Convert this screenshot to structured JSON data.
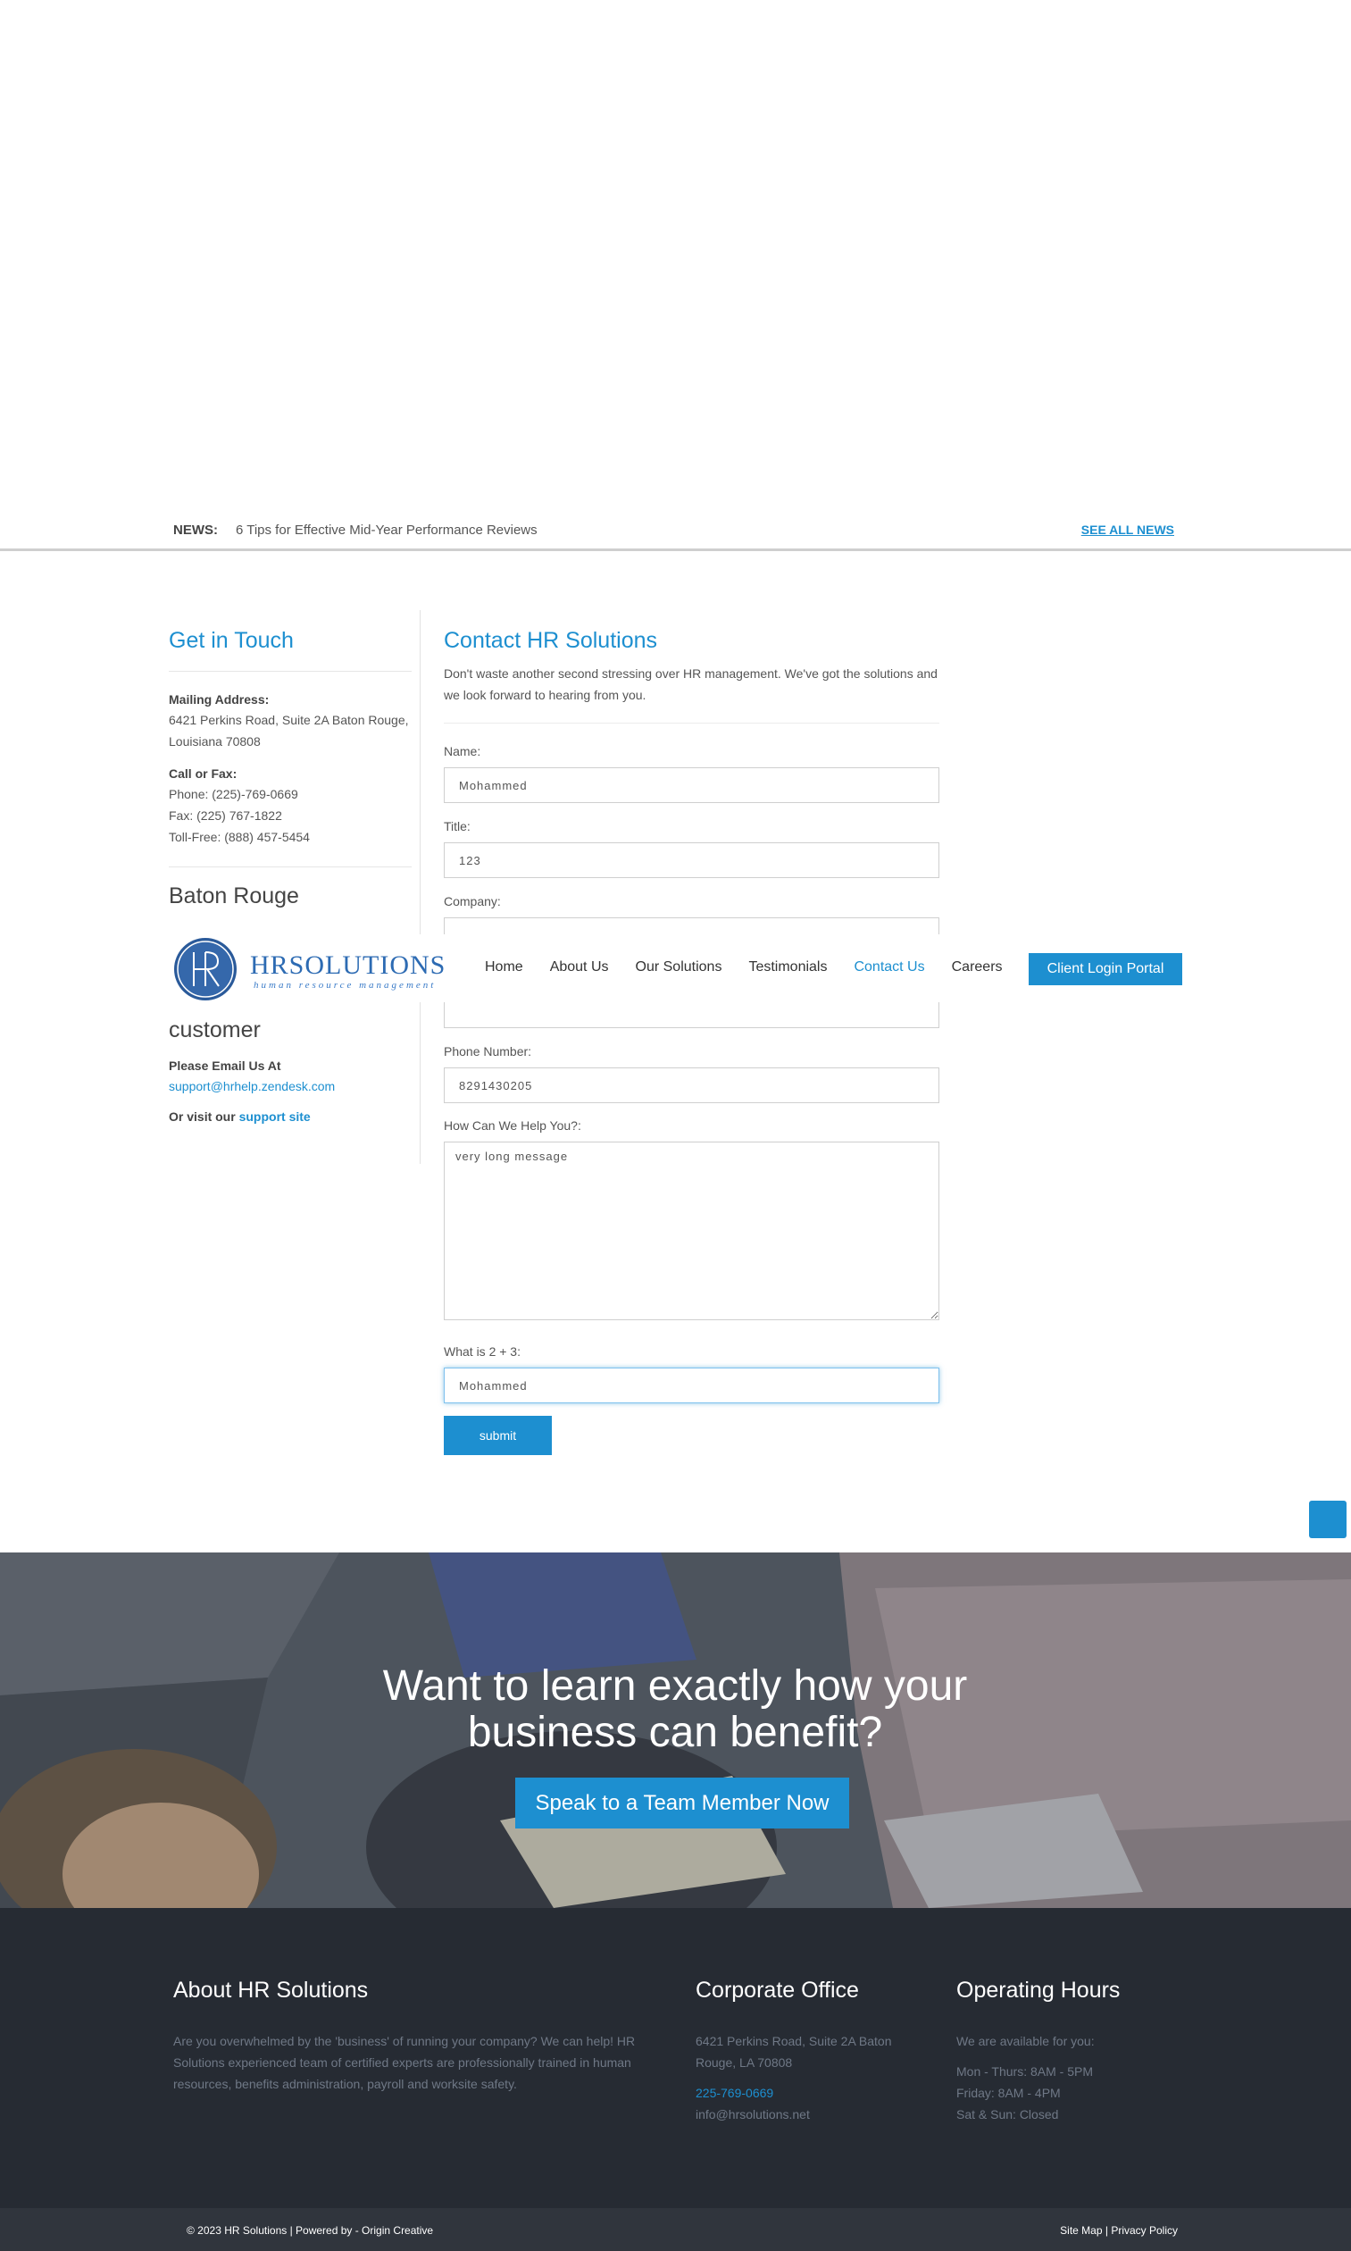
{
  "news": {
    "label": "NEWS:",
    "item": "6 Tips for Effective Mid-Year Performance Reviews",
    "see_all": "SEE ALL NEWS"
  },
  "contact_info": {
    "title": "Get in Touch",
    "mailing_label": "Mailing Address:",
    "mailing_line1": "6421 Perkins Road, Suite 2A Baton Rouge,",
    "mailing_line2": "Louisiana 70808",
    "call_label": "Call or Fax:",
    "phone": "Phone: (225)-769-0669",
    "fax": "Fax: (225) 767-1822",
    "tollfree": "Toll-Free: (888) 457-5454",
    "city": "Baton Rouge",
    "customer_partial": "customer",
    "email_label": "Please Email Us At",
    "email": "support@hrhelp.zendesk.com",
    "visit_prefix": "Or visit our ",
    "visit_link": "support site"
  },
  "form": {
    "title": "Contact HR Solutions",
    "intro": "Don't waste another second stressing over HR management. We've got the solutions and we look forward to hearing from you.",
    "name_label": "Name:",
    "name_value": "Mohammed",
    "title_label": "Title:",
    "title_value": "123",
    "company_label": "Company:",
    "phone_label": "Phone Number:",
    "phone_value": "8291430205",
    "help_label": "How Can We Help You?:",
    "help_value": "very long message",
    "captcha_label": "What is 2 + 3:",
    "captcha_value": "Mohammed",
    "submit": "submit"
  },
  "header": {
    "logo_main": "HRSOLUTIONS",
    "logo_sub": "human resource management",
    "nav": [
      "Home",
      "About Us",
      "Our Solutions",
      "Testimonials",
      "Contact Us",
      "Careers"
    ],
    "active": "Contact Us",
    "login": "Client Login Portal"
  },
  "cta": {
    "title": "Want to learn exactly how your business can benefit?",
    "button": "Speak to a Team Member Now"
  },
  "footer": {
    "about_title": "About HR Solutions",
    "about_text": "Are you overwhelmed by the 'business' of running your company? We can help! HR Solutions experienced team of certified experts are professionally trained in human resources, benefits administration, payroll and worksite safety.",
    "office_title": "Corporate Office",
    "office_address": "6421 Perkins Road, Suite 2A Baton Rouge, LA 70808",
    "office_phone": "225-769-0669",
    "office_email": "info@hrsolutions.net",
    "hours_title": "Operating Hours",
    "hours_intro": "We are available for you:",
    "hours_1": "Mon - Thurs: 8AM - 5PM",
    "hours_2": "Friday: 8AM - 4PM",
    "hours_3": "Sat & Sun: Closed",
    "copyright": "© 2023 HR Solutions | Powered by - Origin Creative",
    "links": "Site Map | Privacy Policy"
  },
  "colors": {
    "accent": "#1d8fd0",
    "footer_bg": "#262b33",
    "bottom_bg": "#30353d"
  }
}
